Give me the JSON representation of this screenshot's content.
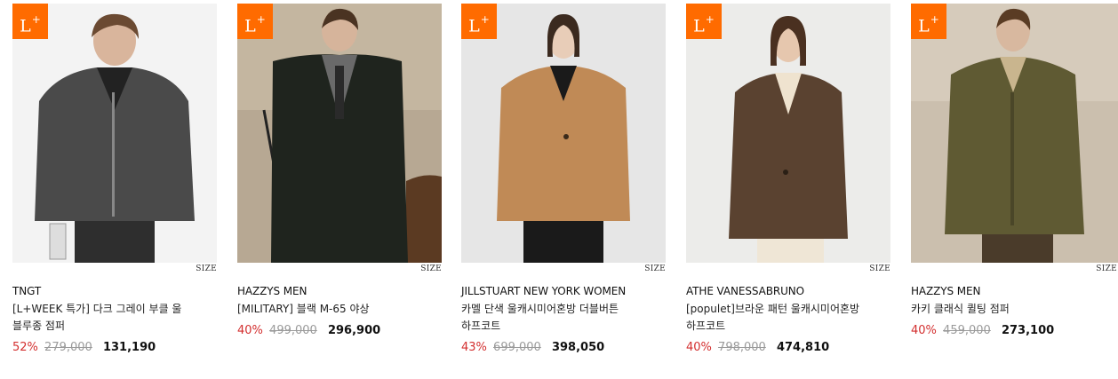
{
  "badge": {
    "text": "L",
    "sup": "+"
  },
  "size_label": "SIZE",
  "products": [
    {
      "brand": "TNGT",
      "name": "[L+WEEK 특가] 다크 그레이 부클 울 블루종 점퍼",
      "discount": "52%",
      "original_price": "279,000",
      "sale_price": "131,190"
    },
    {
      "brand": "HAZZYS MEN",
      "name": "[MILITARY] 블랙 M-65 야상",
      "discount": "40%",
      "original_price": "499,000",
      "sale_price": "296,900"
    },
    {
      "brand": "JILLSTUART NEW YORK WOMEN",
      "name": "카멜 단색 울캐시미어혼방 더블버튼 하프코트",
      "discount": "43%",
      "original_price": "699,000",
      "sale_price": "398,050"
    },
    {
      "brand": "ATHE VANESSABRUNO",
      "name": "[populet]브라운 패턴 울캐시미어혼방 하프코트",
      "discount": "40%",
      "original_price": "798,000",
      "sale_price": "474,810"
    },
    {
      "brand": "HAZZYS MEN",
      "name": "카키 클래식 퀼팅 점퍼",
      "discount": "40%",
      "original_price": "459,000",
      "sale_price": "273,100"
    }
  ],
  "colors": {
    "badge": "#ff6b00",
    "discount": "#d32f2f",
    "original_price": "#9a9a9a"
  }
}
